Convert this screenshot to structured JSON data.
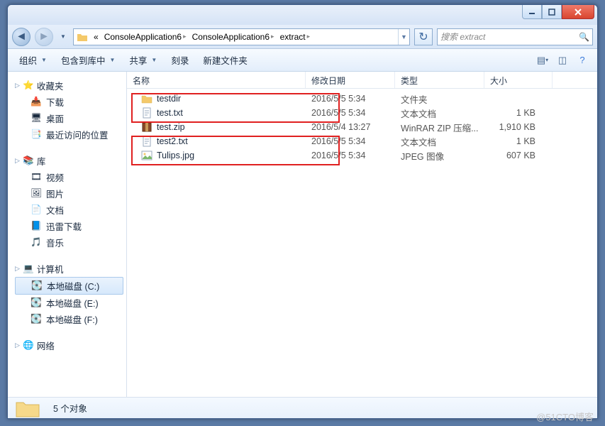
{
  "breadcrumbs": {
    "prefix": "«",
    "items": [
      "ConsoleApplication6",
      "ConsoleApplication6",
      "extract"
    ]
  },
  "search": {
    "placeholder": "搜索 extract"
  },
  "toolbar": {
    "organize": "组织",
    "include": "包含到库中",
    "share": "共享",
    "burn": "刻录",
    "newfolder": "新建文件夹"
  },
  "columns": {
    "name": "名称",
    "date": "修改日期",
    "type": "类型",
    "size": "大小"
  },
  "nav": {
    "favorites": {
      "label": "收藏夹",
      "items": [
        "下载",
        "桌面",
        "最近访问的位置"
      ]
    },
    "libraries": {
      "label": "库",
      "items": [
        "视频",
        "图片",
        "文档",
        "迅雷下载",
        "音乐"
      ]
    },
    "computer": {
      "label": "计算机",
      "items": [
        "本地磁盘 (C:)",
        "本地磁盘 (E:)",
        "本地磁盘 (F:)"
      ],
      "selected": 0
    },
    "network": {
      "label": "网络"
    }
  },
  "files": [
    {
      "name": "testdir",
      "date": "2016/5/5 5:34",
      "type": "文件夹",
      "size": "",
      "icon": "folder"
    },
    {
      "name": "test.txt",
      "date": "2016/5/5 5:34",
      "type": "文本文档",
      "size": "1 KB",
      "icon": "txt"
    },
    {
      "name": "test.zip",
      "date": "2016/5/4 13:27",
      "type": "WinRAR ZIP 压缩...",
      "size": "1,910 KB",
      "icon": "zip"
    },
    {
      "name": "test2.txt",
      "date": "2016/5/5 5:34",
      "type": "文本文档",
      "size": "1 KB",
      "icon": "txt"
    },
    {
      "name": "Tulips.jpg",
      "date": "2016/5/5 5:34",
      "type": "JPEG 图像",
      "size": "607 KB",
      "icon": "img"
    }
  ],
  "status": {
    "count": "5 个对象"
  },
  "watermark": "@51CTO博客"
}
